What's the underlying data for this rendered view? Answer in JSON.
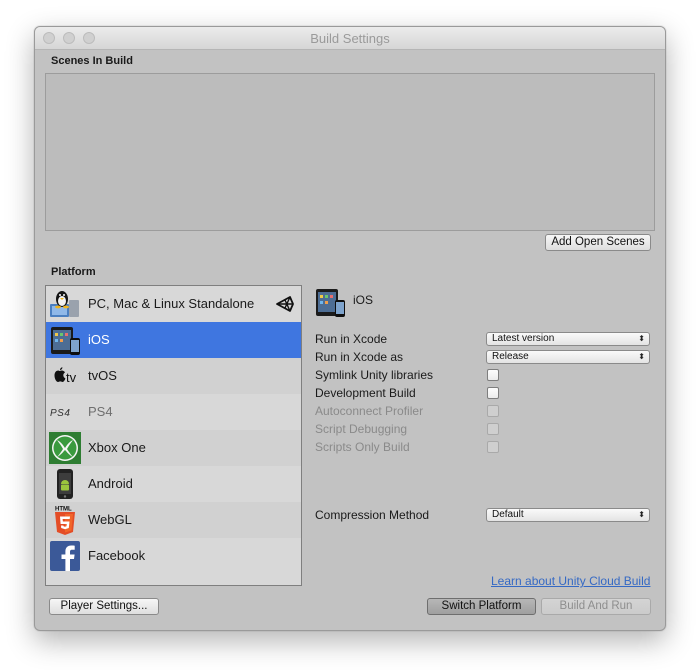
{
  "window": {
    "title": "Build Settings"
  },
  "scenes": {
    "label": "Scenes In Build",
    "add_open_scenes": "Add Open Scenes"
  },
  "platform": {
    "label": "Platform",
    "items": [
      {
        "name": "PC, Mac & Linux Standalone",
        "icon": "pc-linux-icon",
        "active_unity_target": true
      },
      {
        "name": "iOS",
        "icon": "ios-device-icon",
        "selected": true
      },
      {
        "name": "tvOS",
        "icon": "apple-tv-icon"
      },
      {
        "name": "PS4",
        "icon": "ps4-icon",
        "dimmed": true
      },
      {
        "name": "Xbox One",
        "icon": "xbox-icon"
      },
      {
        "name": "Android",
        "icon": "android-icon"
      },
      {
        "name": "WebGL",
        "icon": "html5-icon"
      },
      {
        "name": "Facebook",
        "icon": "facebook-icon"
      }
    ]
  },
  "settings": {
    "title": "iOS",
    "run_in_xcode": {
      "label": "Run in Xcode",
      "value": "Latest version"
    },
    "run_in_xcode_as": {
      "label": "Run in Xcode as",
      "value": "Release"
    },
    "symlink": {
      "label": "Symlink Unity libraries",
      "checked": false
    },
    "development_build": {
      "label": "Development Build",
      "checked": false
    },
    "autoconnect_profiler": {
      "label": "Autoconnect Profiler",
      "disabled": true
    },
    "script_debugging": {
      "label": "Script Debugging",
      "disabled": true
    },
    "scripts_only_build": {
      "label": "Scripts Only Build",
      "disabled": true
    },
    "compression": {
      "label": "Compression Method",
      "value": "Default"
    }
  },
  "footer": {
    "cloud_build_link": "Learn about Unity Cloud Build",
    "player_settings": "Player Settings...",
    "switch_platform": "Switch Platform",
    "build_and_run": "Build And Run"
  },
  "colors": {
    "selection": "#3f76e0",
    "window_bg": "#c2c2c2",
    "link": "#3569c4"
  }
}
